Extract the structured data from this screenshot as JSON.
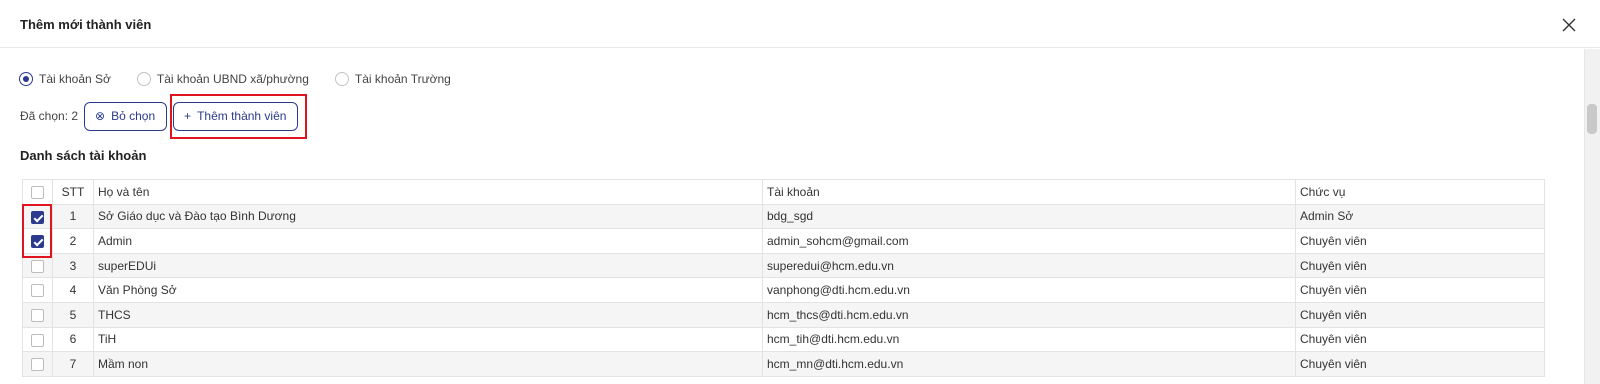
{
  "dialog": {
    "title": "Thêm mới thành viên"
  },
  "account_types": [
    {
      "label": "Tài khoản Sở",
      "checked": true
    },
    {
      "label": "Tài khoản UBND xã/phường",
      "checked": false
    },
    {
      "label": "Tài khoản Trường",
      "checked": false
    }
  ],
  "selection": {
    "text": "Đã chọn: 2",
    "clear_label": "Bỏ chọn",
    "add_label": "Thêm thành viên"
  },
  "list": {
    "title": "Danh sách tài khoản",
    "columns": [
      "STT",
      "Họ và tên",
      "Tài khoản",
      "Chức vụ"
    ],
    "rows": [
      {
        "checked": true,
        "stt": "1",
        "name": "Sở Giáo dục và Đào tạo Bình Dương",
        "account": "bdg_sgd",
        "role": "Admin Sở"
      },
      {
        "checked": true,
        "stt": "2",
        "name": "Admin",
        "account": "admin_sohcm@gmail.com",
        "role": "Chuyên viên"
      },
      {
        "checked": false,
        "stt": "3",
        "name": "superEDUi",
        "account": "superedui@hcm.edu.vn",
        "role": "Chuyên viên"
      },
      {
        "checked": false,
        "stt": "4",
        "name": "Văn Phòng Sở",
        "account": "vanphong@dti.hcm.edu.vn",
        "role": "Chuyên viên"
      },
      {
        "checked": false,
        "stt": "5",
        "name": "THCS",
        "account": "hcm_thcs@dti.hcm.edu.vn",
        "role": "Chuyên viên"
      },
      {
        "checked": false,
        "stt": "6",
        "name": "TiH",
        "account": "hcm_tih@dti.hcm.edu.vn",
        "role": "Chuyên viên"
      },
      {
        "checked": false,
        "stt": "7",
        "name": "Mầm non",
        "account": "hcm_mn@dti.hcm.edu.vn",
        "role": "Chuyên viên"
      }
    ]
  },
  "icons": {
    "close": "close-icon",
    "clear": "circle-x-icon",
    "add": "plus-icon"
  },
  "colors": {
    "accent": "#2b3a8c",
    "highlight": "#e0141e",
    "row_stripe": "#f5f5f5"
  }
}
